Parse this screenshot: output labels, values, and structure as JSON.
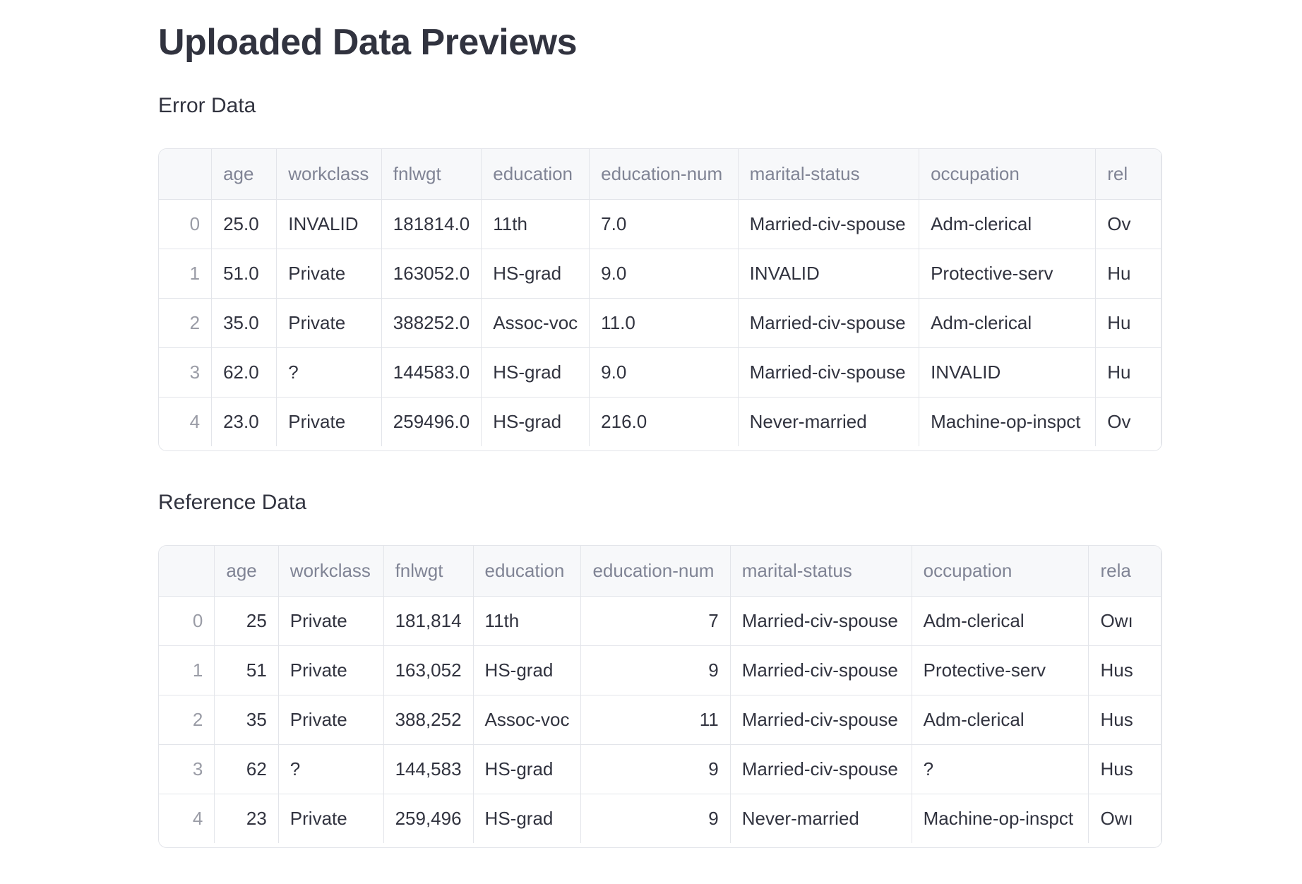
{
  "page": {
    "title": "Uploaded Data Previews"
  },
  "error_section": {
    "title": "Error Data",
    "columns": [
      "age",
      "workclass",
      "fnlwgt",
      "education",
      "education-num",
      "marital-status",
      "occupation",
      "rel"
    ],
    "rows": [
      {
        "index": "0",
        "cells": [
          "25.0",
          "INVALID",
          "181814.0",
          "11th",
          "7.0",
          "Married-civ-spouse",
          "Adm-clerical",
          "Ov"
        ]
      },
      {
        "index": "1",
        "cells": [
          "51.0",
          "Private",
          "163052.0",
          "HS-grad",
          "9.0",
          "INVALID",
          "Protective-serv",
          "Hu"
        ]
      },
      {
        "index": "2",
        "cells": [
          "35.0",
          "Private",
          "388252.0",
          "Assoc-voc",
          "11.0",
          "Married-civ-spouse",
          "Adm-clerical",
          "Hu"
        ]
      },
      {
        "index": "3",
        "cells": [
          "62.0",
          "?",
          "144583.0",
          "HS-grad",
          "9.0",
          "Married-civ-spouse",
          "INVALID",
          "Hu"
        ]
      },
      {
        "index": "4",
        "cells": [
          "23.0",
          "Private",
          "259496.0",
          "HS-grad",
          "216.0",
          "Never-married",
          "Machine-op-inspct",
          "Ov"
        ]
      }
    ]
  },
  "reference_section": {
    "title": "Reference Data",
    "columns": [
      "age",
      "workclass",
      "fnlwgt",
      "education",
      "education-num",
      "marital-status",
      "occupation",
      "rela"
    ],
    "rows": [
      {
        "index": "0",
        "cells": [
          "25",
          "Private",
          "181,814",
          "11th",
          "7",
          "Married-civ-spouse",
          "Adm-clerical",
          "Owı"
        ]
      },
      {
        "index": "1",
        "cells": [
          "51",
          "Private",
          "163,052",
          "HS-grad",
          "9",
          "Married-civ-spouse",
          "Protective-serv",
          "Hus"
        ]
      },
      {
        "index": "2",
        "cells": [
          "35",
          "Private",
          "388,252",
          "Assoc-voc",
          "11",
          "Married-civ-spouse",
          "Adm-clerical",
          "Hus"
        ]
      },
      {
        "index": "3",
        "cells": [
          "62",
          "?",
          "144,583",
          "HS-grad",
          "9",
          "Married-civ-spouse",
          "?",
          "Hus"
        ]
      },
      {
        "index": "4",
        "cells": [
          "23",
          "Private",
          "259,496",
          "HS-grad",
          "9",
          "Never-married",
          "Machine-op-inspct",
          "Owı"
        ]
      }
    ]
  }
}
